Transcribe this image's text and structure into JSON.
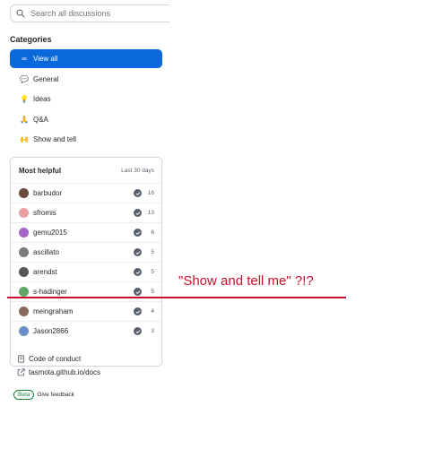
{
  "search": {
    "placeholder": "Search all discussions"
  },
  "categories": {
    "heading": "Categories",
    "items": [
      {
        "label": "View all",
        "emoji": "∞",
        "active": true
      },
      {
        "label": "General",
        "emoji": "💬",
        "active": false
      },
      {
        "label": "Ideas",
        "emoji": "💡",
        "active": false
      },
      {
        "label": "Q&A",
        "emoji": "🙏",
        "active": false
      },
      {
        "label": "Show and tell",
        "emoji": "🙌",
        "active": false
      }
    ]
  },
  "most_helpful": {
    "title": "Most helpful",
    "range": "Last 30 days",
    "users": [
      {
        "name": "barbudor",
        "count": "16",
        "avatar_color": "#6b4b3e"
      },
      {
        "name": "sfromis",
        "count": "13",
        "avatar_color": "#e8a0a0"
      },
      {
        "name": "gemu2015",
        "count": "6",
        "avatar_color": "#a566c9"
      },
      {
        "name": "ascillato",
        "count": "5",
        "avatar_color": "#7a7a7a"
      },
      {
        "name": "arendst",
        "count": "5",
        "avatar_color": "#555555"
      },
      {
        "name": "s-hadinger",
        "count": "5",
        "avatar_color": "#5fa86a"
      },
      {
        "name": "meingraham",
        "count": "4",
        "avatar_color": "#8a6a5a"
      },
      {
        "name": "Jason2866",
        "count": "3",
        "avatar_color": "#6a8fc9"
      }
    ]
  },
  "footer": {
    "code_of_conduct": "Code of conduct",
    "docs_link": "tasmota.github.io/docs"
  },
  "beta": {
    "badge": "Beta",
    "feedback": "Give feedback"
  },
  "annotation": {
    "text": "\"Show and tell me\" ?!?",
    "color": "#c8102e"
  },
  "colors": {
    "accent": "#0969da",
    "success": "#1a7f37"
  }
}
